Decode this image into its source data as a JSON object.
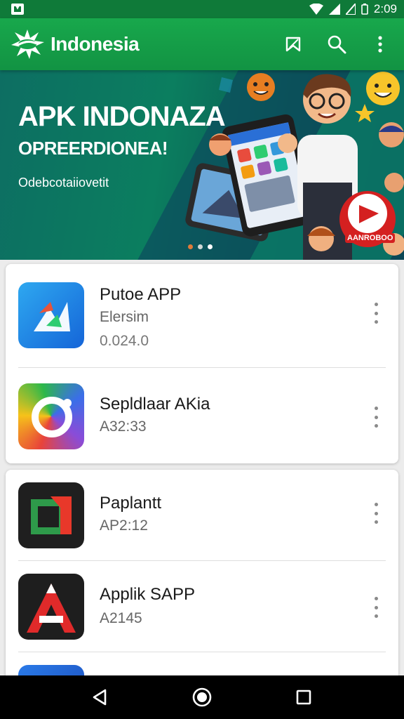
{
  "status": {
    "time": "2:09"
  },
  "header": {
    "title": "Indonesia"
  },
  "banner": {
    "title": "APK INDONAZA",
    "subtitle": "OPREERDIONEA!",
    "small_text": "Odebcotaiiovetit",
    "badge_text": "AANROBOO"
  },
  "apps": [
    {
      "name": "Putoe APP",
      "meta1": "Elersim",
      "meta2": "0.024.0"
    },
    {
      "name": "Sepldlaar AKia",
      "meta1": "A32:33",
      "meta2": ""
    },
    {
      "name": "Paplantt",
      "meta1": "AP2:12",
      "meta2": ""
    },
    {
      "name": "Applik SAPP",
      "meta1": "A2145",
      "meta2": ""
    }
  ],
  "colors": {
    "app_bar": "#16a34a",
    "status_bar": "#0f7a39",
    "banner": "#0b7e5f",
    "nav_bar": "#000000"
  },
  "icons": [
    "logo-icon",
    "bookmark-icon",
    "search-icon",
    "more-vert-icon",
    "back-icon",
    "home-icon",
    "recents-icon"
  ]
}
